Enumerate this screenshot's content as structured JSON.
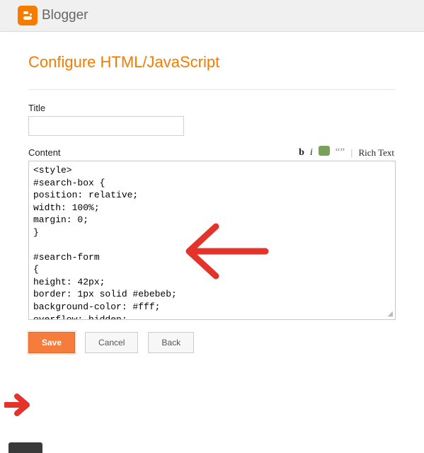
{
  "header": {
    "brand": "Blogger"
  },
  "page": {
    "title": "Configure HTML/JavaScript"
  },
  "form": {
    "title_label": "Title",
    "title_value": "",
    "content_label": "Content",
    "content_value": "<style>\n#search-box {\nposition: relative;\nwidth: 100%;\nmargin: 0;\n}\n\n#search-form\n{\nheight: 42px;\nborder: 1px solid #ebebeb;\nbackground-color: #fff;\noverflow: hidden;\n}\n#search-text\n{"
  },
  "toolbar": {
    "bold": "b",
    "italic": "i",
    "quote": "“”",
    "richtext": "Rich Text"
  },
  "buttons": {
    "save": "Save",
    "cancel": "Cancel",
    "back": "Back"
  }
}
